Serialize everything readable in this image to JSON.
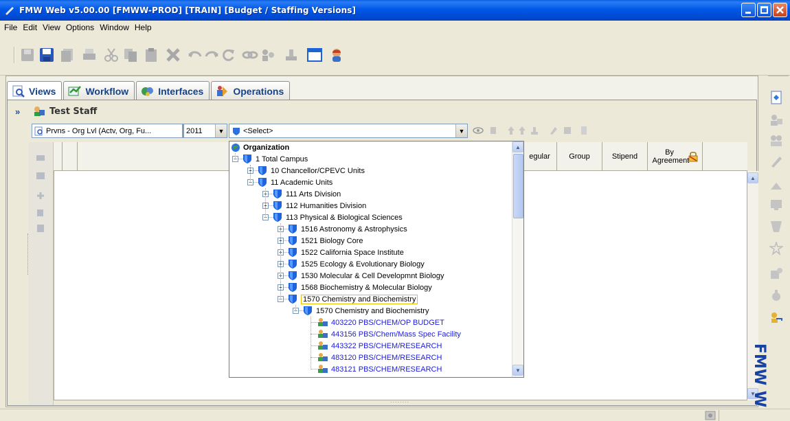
{
  "window": {
    "title": "FMW Web v5.00.00 [FMWW-PROD] [TRAIN] [Budget / Staffing Versions]"
  },
  "menu": [
    "File",
    "Edit",
    "View",
    "Options",
    "Window",
    "Help"
  ],
  "toolbar_icons": [
    "save-all-icon",
    "save-icon",
    "copy-doc-icon",
    "print-icon",
    "cut-icon",
    "copy-icon",
    "paste-icon",
    "delete-icon",
    "undo-icon",
    "redo-icon",
    "refresh-icon",
    "link-icon",
    "people-link-icon",
    "stamp-icon",
    "window-icon",
    "user-help-icon"
  ],
  "tabs": [
    {
      "label": "Views",
      "icon": "views-icon",
      "active": true
    },
    {
      "label": "Workflow",
      "icon": "workflow-icon",
      "active": false
    },
    {
      "label": "Interfaces",
      "icon": "interfaces-icon",
      "active": false
    },
    {
      "label": "Operations",
      "icon": "operations-icon",
      "active": false
    }
  ],
  "panel_title": "Test Staff",
  "filters": {
    "view": "Prvns - Org Lvl (Actv, Org, Fu...",
    "year": "2011",
    "org": "<Select>"
  },
  "columns": [
    "egular",
    "Group",
    "Stipend",
    "By Agreement"
  ],
  "tree": {
    "root": "Organization",
    "rows": [
      {
        "code": "1",
        "name": "Total Campus",
        "level": 0,
        "state": "expanded",
        "kind": "org"
      },
      {
        "code": "10",
        "name": "Chancellor/CPEVC Units",
        "level": 1,
        "state": "collapsed",
        "kind": "org"
      },
      {
        "code": "11",
        "name": "Academic Units",
        "level": 1,
        "state": "expanded",
        "kind": "org"
      },
      {
        "code": "111",
        "name": "Arts Division",
        "level": 2,
        "state": "collapsed",
        "kind": "org"
      },
      {
        "code": "112",
        "name": "Humanities Division",
        "level": 2,
        "state": "collapsed",
        "kind": "org"
      },
      {
        "code": "113",
        "name": "Physical & Biological Sciences",
        "level": 2,
        "state": "expanded",
        "kind": "org"
      },
      {
        "code": "1516",
        "name": "Astronomy & Astrophysics",
        "level": 3,
        "state": "collapsed",
        "kind": "org"
      },
      {
        "code": "1521",
        "name": "Biology Core",
        "level": 3,
        "state": "collapsed",
        "kind": "org"
      },
      {
        "code": "1522",
        "name": "California Space Institute",
        "level": 3,
        "state": "collapsed",
        "kind": "org"
      },
      {
        "code": "1525",
        "name": "Ecology & Evolutionary Biology",
        "level": 3,
        "state": "collapsed",
        "kind": "org"
      },
      {
        "code": "1530",
        "name": "Molecular & Cell Developmnt Biology",
        "level": 3,
        "state": "collapsed",
        "kind": "org"
      },
      {
        "code": "1568",
        "name": "Biochemistry & Molecular Biology",
        "level": 3,
        "state": "collapsed",
        "kind": "org"
      },
      {
        "code": "1570",
        "name": "Chemistry and Biochemistry",
        "level": 3,
        "state": "expanded",
        "kind": "org",
        "selected": true
      },
      {
        "code": "1570",
        "name": "Chemistry and Biochemistry",
        "level": 4,
        "state": "expanded",
        "kind": "org"
      },
      {
        "code": "",
        "name": "403220 PBS/CHEM/OP BUDGET",
        "level": 5,
        "state": "leaf",
        "kind": "leaf"
      },
      {
        "code": "",
        "name": "443156 PBS/Chem/Mass Spec Facility",
        "level": 5,
        "state": "leaf",
        "kind": "leaf"
      },
      {
        "code": "",
        "name": "443322 PBS/CHEM/RESEARCH",
        "level": 5,
        "state": "leaf",
        "kind": "leaf"
      },
      {
        "code": "",
        "name": "483120 PBS/CHEM/RESEARCH",
        "level": 5,
        "state": "leaf",
        "kind": "leaf"
      },
      {
        "code": "",
        "name": "483121 PBS/CHEM/RESEARCH",
        "level": 5,
        "state": "leaf",
        "kind": "leaf"
      }
    ]
  },
  "side_label": "FMW W",
  "colors": {
    "titlebar": "#0058E6",
    "tab_text": "#14428A",
    "leaf_text": "#1A1AE0",
    "selection_border": "#E5C100",
    "fmw_blue": "#1743A4"
  }
}
